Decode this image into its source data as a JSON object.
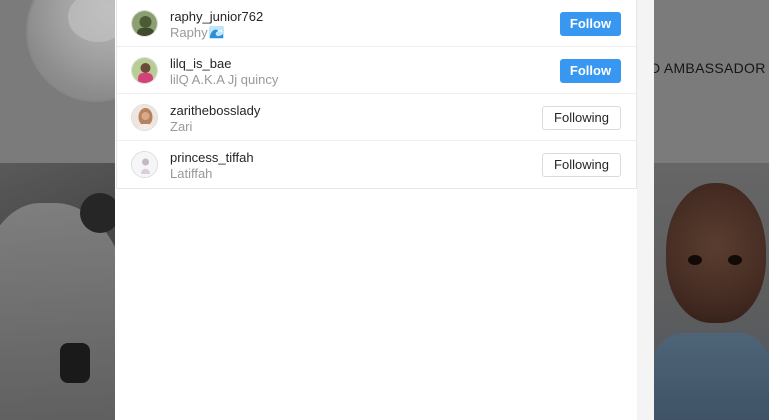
{
  "background": {
    "profile_text": "D AMBASSADOR I"
  },
  "list": [
    {
      "username": "raphy_junior762",
      "fullname": "Raphy",
      "emoji": "wave",
      "button": "Follow",
      "button_state": "follow",
      "avatar_color": "#6a8a4a"
    },
    {
      "username": "lilq_is_bae",
      "fullname": "lilQ A.K.A Jj quincy",
      "button": "Follow",
      "button_state": "follow",
      "avatar_color": "#c9456e"
    },
    {
      "username": "zarithebosslady",
      "fullname": "Zari",
      "button": "Following",
      "button_state": "following",
      "avatar_color": "#c79a7c"
    },
    {
      "username": "princess_tiffah",
      "fullname": "Latiffah",
      "button": "Following",
      "button_state": "following",
      "avatar_color": "#e8e6ea"
    }
  ],
  "colors": {
    "follow_blue": "#3897f0",
    "overlay": "#6f6f6f"
  }
}
